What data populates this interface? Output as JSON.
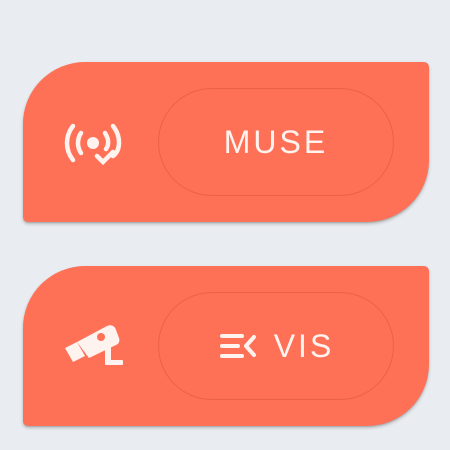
{
  "colors": {
    "background": "#e9ecf0",
    "card": "#ff7157",
    "foreground": "#fff3ef"
  },
  "cards": [
    {
      "icon": "wireless-broadcast-check-icon",
      "button": {
        "label": "MUSE",
        "icon": null
      }
    },
    {
      "icon": "security-camera-icon",
      "button": {
        "label": "VIS",
        "icon": "menu-open-icon"
      }
    }
  ]
}
